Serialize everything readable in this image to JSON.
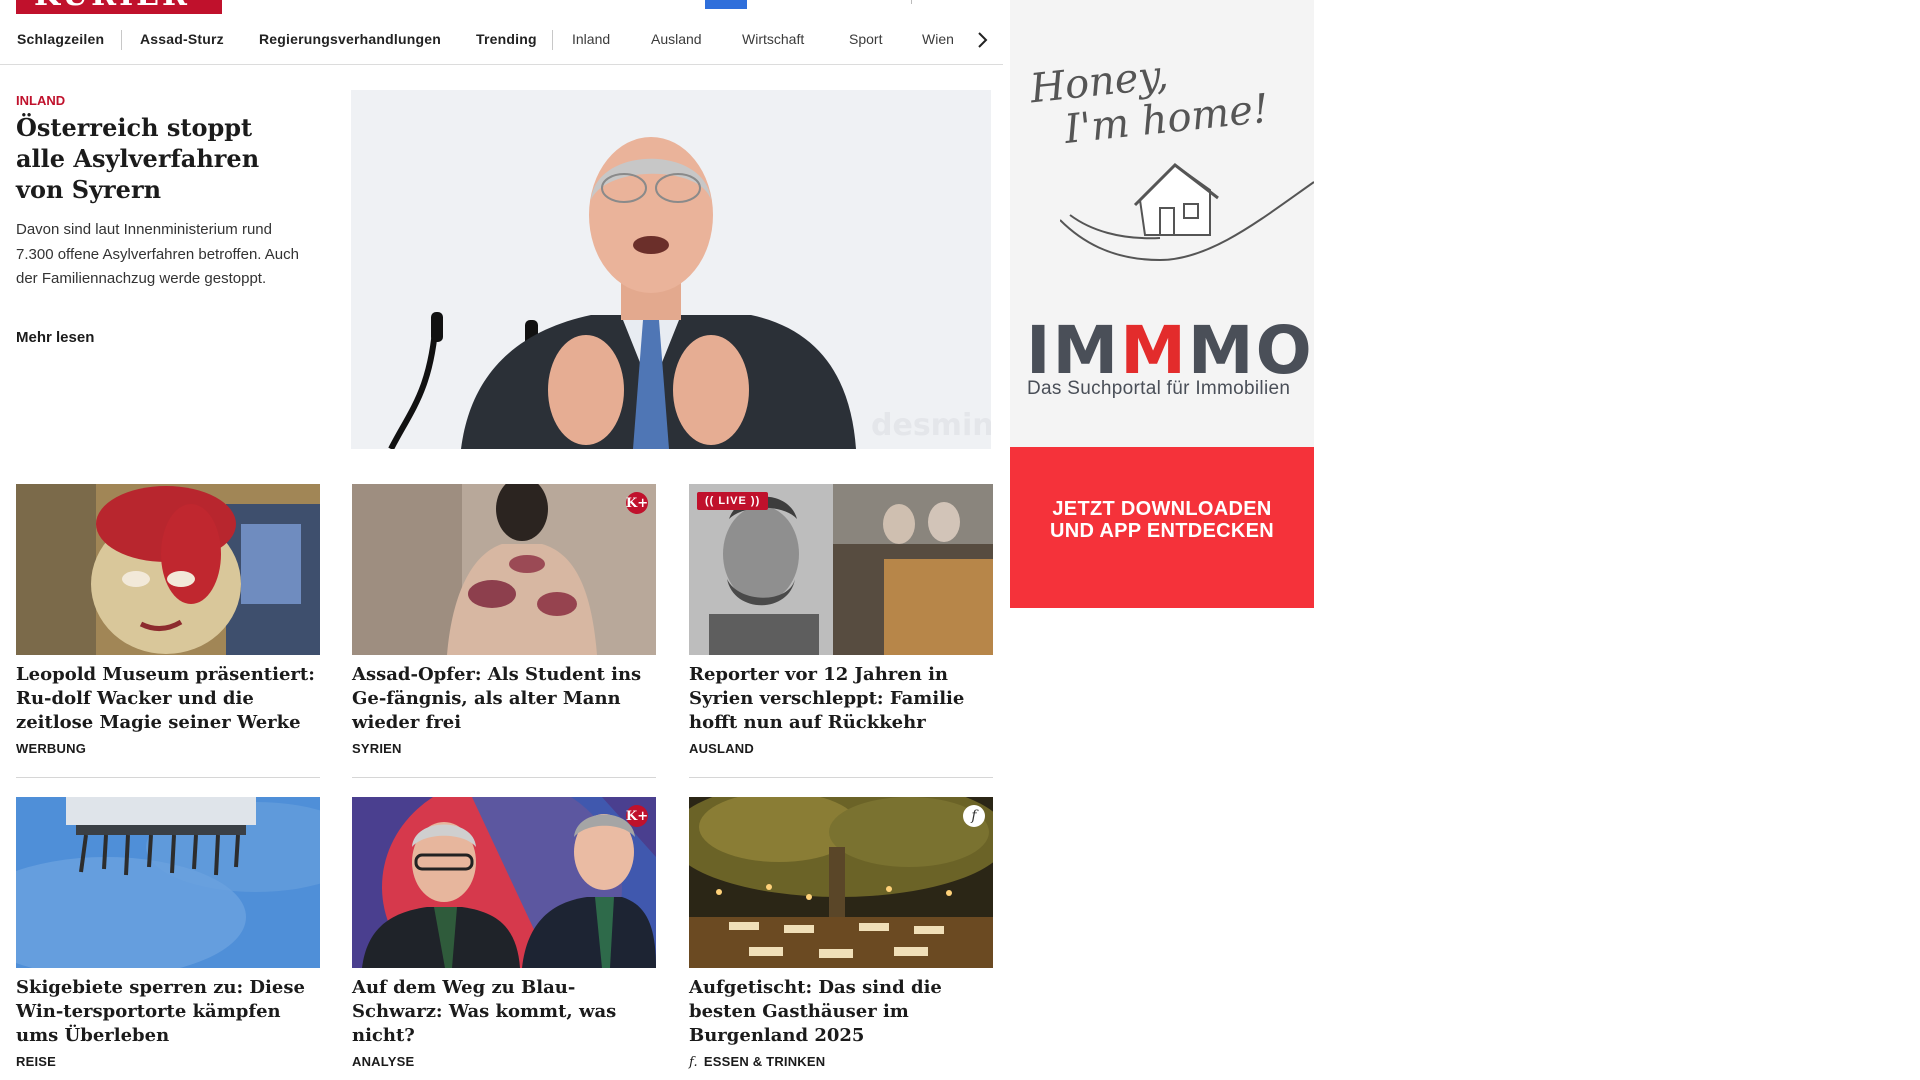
{
  "header": {
    "logo_text": "KURIER"
  },
  "nav": {
    "items": [
      {
        "label": "Schlagzeilen"
      },
      {
        "label": "Assad-Sturz"
      },
      {
        "label": "Regierungsverhandlungen"
      },
      {
        "label": "Trending"
      },
      {
        "label": "Inland"
      },
      {
        "label": "Ausland"
      },
      {
        "label": "Wirtschaft"
      },
      {
        "label": "Sport"
      },
      {
        "label": "Wien"
      }
    ],
    "next_icon": "chevron-right-icon"
  },
  "lead": {
    "category": "INLAND",
    "title": "Österreich stoppt alle Asylverfahren von Syrern",
    "teaser": "Davon sind laut Innenministerium rund 7.300 offene Asylverfahren betroffen. Auch der Familiennachzug werde gestoppt.",
    "more": "Mehr lesen",
    "image_watermark": "desmin"
  },
  "cards": [
    {
      "title": "Leopold Museum präsentiert: Ru-dolf Wacker und die zeitlose Magie seiner Werke",
      "category": "WERBUNG"
    },
    {
      "title": "Assad-Opfer: Als Student ins Ge-fängnis, als alter Mann wieder frei",
      "category": "SYRIEN",
      "badge": "K+"
    },
    {
      "title": "Reporter vor 12 Jahren in Syrien verschleppt: Familie hofft nun auf Rückkehr",
      "category": "AUSLAND",
      "live": "LIVE"
    },
    {
      "title": "Skigebiete sperren zu: Diese Win-tersportorte kämpfen ums Überleben",
      "category": "REISE"
    },
    {
      "title": "Auf dem Weg zu Blau-Schwarz: Was kommt, was nicht?",
      "category": "ANALYSE",
      "badge": "K+"
    },
    {
      "title": "Aufgetischt: Das sind die besten Gasthäuser im Burgenland 2025",
      "category": "ESSEN & TRINKEN",
      "badge": "f"
    }
  ],
  "ad": {
    "tagline_1": "Honey,",
    "tagline_2": "I'm home!",
    "brand_a": "IM",
    "brand_b": "M",
    "brand_c": "MO",
    "subtitle": "Das Suchportal für Immobilien",
    "cta_1": "JETZT DOWNLOADEN",
    "cta_2": "UND APP ENTDECKEN"
  },
  "colors": {
    "brand_red": "#c0112c",
    "ad_red": "#f5323a"
  }
}
